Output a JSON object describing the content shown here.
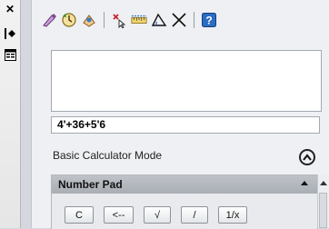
{
  "window": {
    "close_glyph": "✕",
    "autohide_glyph": "|◂▸",
    "properties_glyph": "▤"
  },
  "toolbar": {
    "buttons": [
      {
        "icon": "clear-icon"
      },
      {
        "icon": "history-icon"
      },
      {
        "icon": "get-coordinates-icon"
      },
      {
        "icon": "distance-icon"
      },
      {
        "icon": "angle-icon"
      },
      {
        "icon": "intersection-icon"
      },
      {
        "icon": "help-icon",
        "label": "?"
      }
    ]
  },
  "input": {
    "value": "4'+36+5'6"
  },
  "mode": {
    "label": "Basic Calculator Mode"
  },
  "number_pad": {
    "title": "Number Pad",
    "keys": [
      "C",
      "<--",
      "√",
      "/",
      "1/x"
    ]
  },
  "colors": {
    "panel_bg": "#eef0f3",
    "header_bg": "#b3b7bd",
    "accent_blue": "#2b6cc4",
    "accent_red": "#c8262b"
  }
}
